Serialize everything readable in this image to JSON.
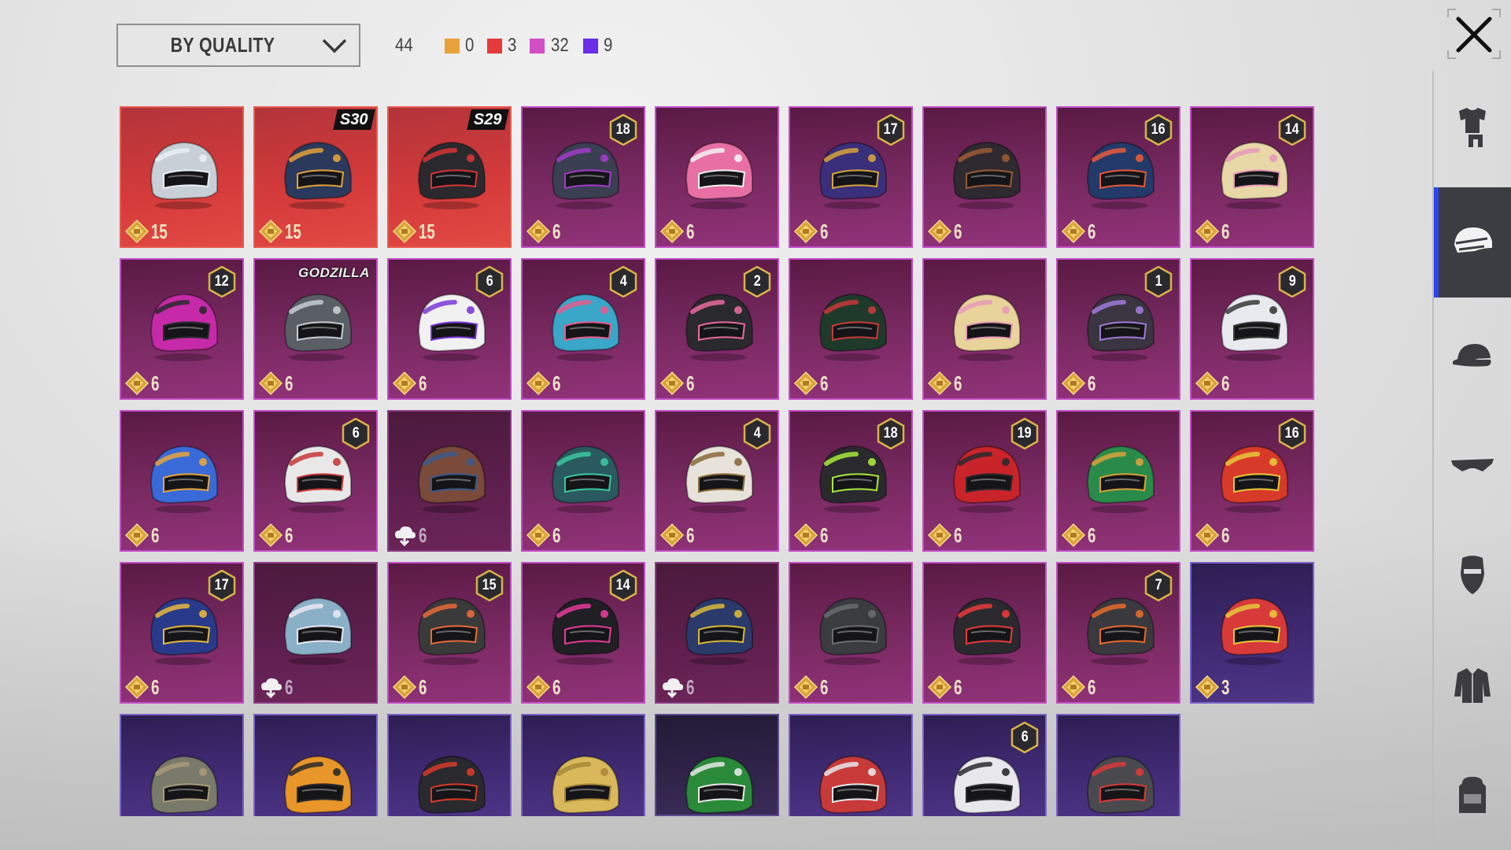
{
  "toolbar": {
    "sort_label": "BY QUALITY",
    "total": "44",
    "quality_counts": [
      {
        "color": "#e8a13a",
        "count": "0"
      },
      {
        "color": "#e53a3a",
        "count": "3"
      },
      {
        "color": "#d24fc3",
        "count": "32"
      },
      {
        "color": "#6b2ee8",
        "count": "9"
      }
    ]
  },
  "sidebar": {
    "categories": [
      {
        "name": "outfits",
        "icon": "outfit-icon",
        "active": false
      },
      {
        "name": "helmets",
        "icon": "helmet-icon",
        "active": true
      },
      {
        "name": "hats",
        "icon": "cap-icon",
        "active": false
      },
      {
        "name": "eyewear",
        "icon": "glasses-icon",
        "active": false
      },
      {
        "name": "masks",
        "icon": "mask-icon",
        "active": false
      },
      {
        "name": "tops",
        "icon": "jacket-icon",
        "active": false
      },
      {
        "name": "backpacks",
        "icon": "backpack-icon",
        "active": false
      }
    ]
  },
  "items": [
    {
      "quality": "legendary",
      "price": "15",
      "badge": "",
      "tag": "",
      "owned": true,
      "color": "#c9cfd6",
      "accent": "#e8eef5"
    },
    {
      "quality": "legendary",
      "price": "15",
      "badge": "",
      "tag": "S30",
      "owned": true,
      "color": "#2b3a5c",
      "accent": "#e3a13a"
    },
    {
      "quality": "legendary",
      "price": "15",
      "badge": "",
      "tag": "S29",
      "owned": true,
      "color": "#2a2a2e",
      "accent": "#d83434"
    },
    {
      "quality": "epic",
      "price": "6",
      "badge": "18",
      "tag": "",
      "owned": true,
      "color": "#3b3f52",
      "accent": "#a33ac9"
    },
    {
      "quality": "epic",
      "price": "6",
      "badge": "",
      "tag": "",
      "owned": true,
      "color": "#e86fa4",
      "accent": "#f3f3f3"
    },
    {
      "quality": "epic",
      "price": "6",
      "badge": "17",
      "tag": "",
      "owned": true,
      "color": "#3a2f7a",
      "accent": "#d7a23b"
    },
    {
      "quality": "epic",
      "price": "6",
      "badge": "",
      "tag": "",
      "owned": true,
      "color": "#2e2a30",
      "accent": "#9a5a34"
    },
    {
      "quality": "epic",
      "price": "6",
      "badge": "16",
      "tag": "",
      "owned": true,
      "color": "#233a6a",
      "accent": "#e85a3a"
    },
    {
      "quality": "epic",
      "price": "6",
      "badge": "14",
      "tag": "",
      "owned": true,
      "color": "#e8d8a8",
      "accent": "#e89ab8"
    },
    {
      "quality": "epic",
      "price": "6",
      "badge": "12",
      "tag": "",
      "owned": true,
      "color": "#c62aa8",
      "accent": "#2a2a2e"
    },
    {
      "quality": "epic",
      "price": "6",
      "badge": "",
      "tag": "GODZILLA",
      "owned": true,
      "color": "#5a5f66",
      "accent": "#c8cdd2"
    },
    {
      "quality": "epic",
      "price": "6",
      "badge": "6",
      "tag": "",
      "owned": true,
      "color": "#f1f1f1",
      "accent": "#7a3ad8"
    },
    {
      "quality": "epic",
      "price": "6",
      "badge": "4",
      "tag": "",
      "owned": true,
      "color": "#3aa6c8",
      "accent": "#e85a8a"
    },
    {
      "quality": "epic",
      "price": "6",
      "badge": "2",
      "tag": "",
      "owned": true,
      "color": "#2a2a2e",
      "accent": "#e86aa0"
    },
    {
      "quality": "epic",
      "price": "6",
      "badge": "",
      "tag": "",
      "owned": true,
      "color": "#1f3a2a",
      "accent": "#c83a3a"
    },
    {
      "quality": "epic",
      "price": "6",
      "badge": "",
      "tag": "",
      "owned": true,
      "color": "#e8d39a",
      "accent": "#e89ab8"
    },
    {
      "quality": "epic",
      "price": "6",
      "badge": "1",
      "tag": "",
      "owned": true,
      "color": "#3a3540",
      "accent": "#a07ad8"
    },
    {
      "quality": "epic",
      "price": "6",
      "badge": "9",
      "tag": "",
      "owned": true,
      "color": "#e8eaf0",
      "accent": "#3a3a3a"
    },
    {
      "quality": "epic",
      "price": "6",
      "badge": "",
      "tag": "",
      "owned": true,
      "color": "#3a6ad8",
      "accent": "#e8a53a"
    },
    {
      "quality": "epic",
      "price": "6",
      "badge": "6",
      "tag": "",
      "owned": true,
      "color": "#e8e8e8",
      "accent": "#c83a3a"
    },
    {
      "quality": "epic dim",
      "price": "6",
      "badge": "",
      "tag": "",
      "owned": false,
      "color": "#7a4a3a",
      "accent": "#3a5a8a"
    },
    {
      "quality": "epic",
      "price": "6",
      "badge": "",
      "tag": "",
      "owned": true,
      "color": "#2a5a5f",
      "accent": "#3ac8a0"
    },
    {
      "quality": "epic",
      "price": "6",
      "badge": "4",
      "tag": "",
      "owned": true,
      "color": "#e8e3da",
      "accent": "#8a6a3a"
    },
    {
      "quality": "epic",
      "price": "6",
      "badge": "18",
      "tag": "",
      "owned": true,
      "color": "#2a2a2e",
      "accent": "#a8e83a"
    },
    {
      "quality": "epic",
      "price": "6",
      "badge": "19",
      "tag": "",
      "owned": true,
      "color": "#c8242a",
      "accent": "#2a2a2e"
    },
    {
      "quality": "epic",
      "price": "6",
      "badge": "",
      "tag": "",
      "owned": true,
      "color": "#2a8a4a",
      "accent": "#d8a23a"
    },
    {
      "quality": "epic",
      "price": "6",
      "badge": "16",
      "tag": "",
      "owned": true,
      "color": "#d83a2a",
      "accent": "#e8c83a"
    },
    {
      "quality": "epic",
      "price": "6",
      "badge": "17",
      "tag": "",
      "owned": true,
      "color": "#2a3a8a",
      "accent": "#e8b83a"
    },
    {
      "quality": "epic dim",
      "price": "6",
      "badge": "",
      "tag": "",
      "owned": false,
      "color": "#8ab0c8",
      "accent": "#e8e8f0"
    },
    {
      "quality": "epic",
      "price": "6",
      "badge": "15",
      "tag": "",
      "owned": true,
      "color": "#3a3a3a",
      "accent": "#e86a3a"
    },
    {
      "quality": "epic",
      "price": "6",
      "badge": "14",
      "tag": "",
      "owned": true,
      "color": "#1f1f24",
      "accent": "#e83a9a"
    },
    {
      "quality": "epic dim",
      "price": "6",
      "badge": "",
      "tag": "",
      "owned": false,
      "color": "#2a3a6a",
      "accent": "#d8b83a"
    },
    {
      "quality": "epic",
      "price": "6",
      "badge": "",
      "tag": "",
      "owned": true,
      "color": "#3a3c40",
      "accent": "#6a6c70"
    },
    {
      "quality": "epic",
      "price": "6",
      "badge": "",
      "tag": "",
      "owned": true,
      "color": "#2a2a2e",
      "accent": "#e83a3a"
    },
    {
      "quality": "epic",
      "price": "6",
      "badge": "7",
      "tag": "",
      "owned": true,
      "color": "#3a3a3e",
      "accent": "#e86a2a"
    },
    {
      "quality": "rare",
      "price": "3",
      "badge": "",
      "tag": "",
      "owned": true,
      "color": "#d83a3a",
      "accent": "#e8c83a"
    },
    {
      "quality": "rare cut",
      "price": "",
      "badge": "",
      "tag": "",
      "owned": true,
      "color": "#7a7a6a",
      "accent": "#a89a7a"
    },
    {
      "quality": "rare cut",
      "price": "",
      "badge": "",
      "tag": "",
      "owned": true,
      "color": "#e8962a",
      "accent": "#2a2a2a"
    },
    {
      "quality": "rare cut",
      "price": "",
      "badge": "",
      "tag": "",
      "owned": true,
      "color": "#2a2a2e",
      "accent": "#d83a2a"
    },
    {
      "quality": "rare cut",
      "price": "",
      "badge": "",
      "tag": "",
      "owned": true,
      "color": "#d8b85a",
      "accent": "#a8883a"
    },
    {
      "quality": "rare dim cut",
      "price": "",
      "badge": "",
      "tag": "",
      "owned": true,
      "color": "#2a8a3a",
      "accent": "#e8e8e8"
    },
    {
      "quality": "rare cut",
      "price": "",
      "badge": "",
      "tag": "",
      "owned": true,
      "color": "#c83a3a",
      "accent": "#e8e8e8"
    },
    {
      "quality": "rare cut",
      "price": "",
      "badge": "6",
      "tag": "",
      "owned": true,
      "color": "#e8e8ec",
      "accent": "#2a2a2e"
    },
    {
      "quality": "rare cut",
      "price": "",
      "badge": "",
      "tag": "",
      "owned": true,
      "color": "#4a4a4e",
      "accent": "#d83a3a"
    }
  ]
}
